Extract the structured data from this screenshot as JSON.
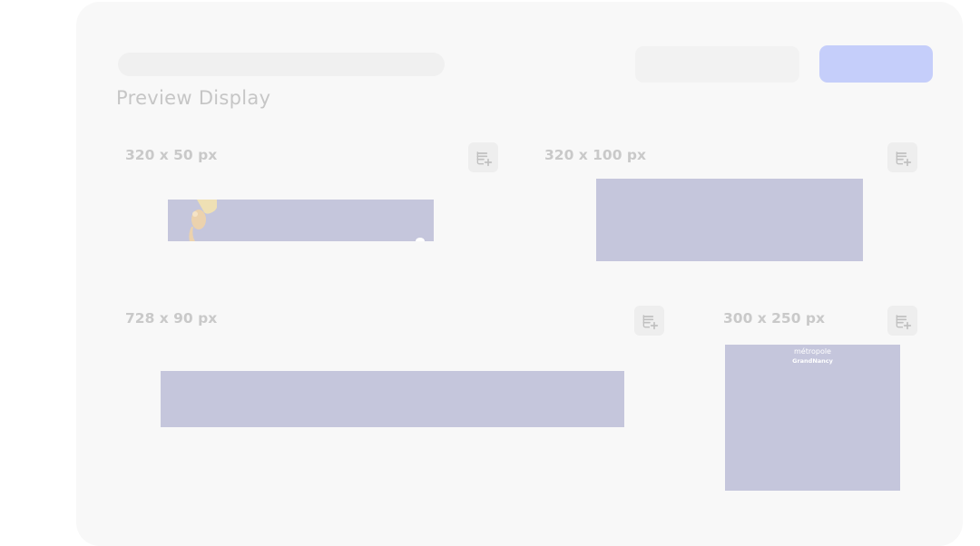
{
  "header": {
    "title": "Preview Display"
  },
  "previews": [
    {
      "size_label": "320 x 50 px"
    },
    {
      "size_label": "320 x 100 px"
    },
    {
      "size_label": "728 x 90 px"
    },
    {
      "size_label": "300 x 250 px",
      "brand_line1": "métropole",
      "brand_line2": "GrandNancy"
    }
  ],
  "icons": {
    "add_to_list": "playlist-add-icon"
  },
  "colors": {
    "accent_button": "#c5cefa",
    "ad_slot_fill": "#c5c6dc",
    "panel_background": "#f8f8f8"
  }
}
